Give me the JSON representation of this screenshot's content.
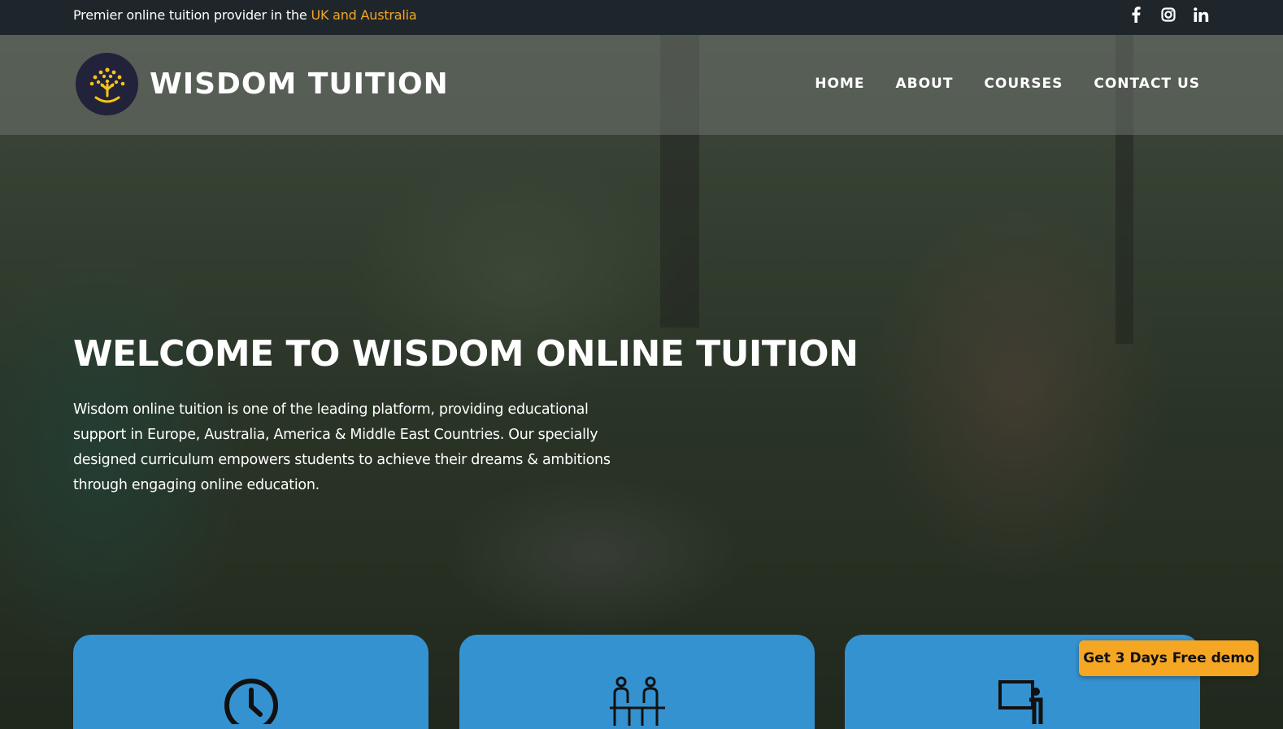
{
  "topbar": {
    "tagline_prefix": "Premier online tuition provider in the ",
    "tagline_highlight": "UK and Australia",
    "socials": [
      {
        "name": "facebook-icon",
        "glyph": "f"
      },
      {
        "name": "instagram-icon",
        "glyph": ""
      },
      {
        "name": "linkedin-icon",
        "glyph": "in"
      }
    ]
  },
  "header": {
    "brand": "WISDOM TUITION",
    "nav": [
      {
        "label": "HOME"
      },
      {
        "label": "ABOUT"
      },
      {
        "label": "COURSES"
      },
      {
        "label": "CONTACT US"
      }
    ]
  },
  "hero": {
    "title": "WELCOME TO WISDOM ONLINE TUITION",
    "text": "Wisdom online tuition is one of the leading platform, providing educational support in Europe, Australia, America & Middle East Countries. Our specially designed curriculum empowers students to achieve their dreams & ambitions through engaging online education."
  },
  "cards": [
    {
      "icon": "clock-icon"
    },
    {
      "icon": "students-desk-icon"
    },
    {
      "icon": "teacher-board-icon"
    }
  ],
  "cta": {
    "label": "Get 3 Days Free demo"
  },
  "colors": {
    "accent": "#f5a623",
    "card": "#3592d0",
    "topbar": "#1e262b"
  }
}
